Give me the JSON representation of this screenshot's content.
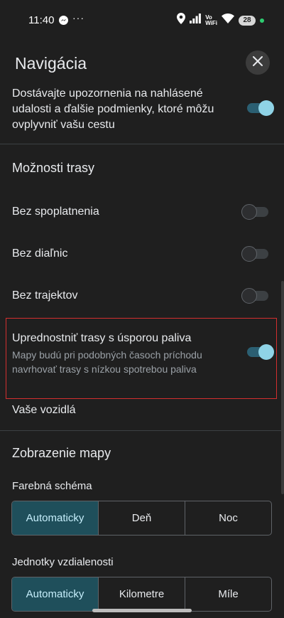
{
  "status_bar": {
    "time": "11:40",
    "dots": "···",
    "vowifi_top": "Vo",
    "vowifi_bottom": "WiFi",
    "battery": "28"
  },
  "header": {
    "title": "Navigácia",
    "close_icon": "close-icon"
  },
  "alerts_row": {
    "text": "Dostávajte upozornenia na nahlásené udalosti a ďalšie podmienky, ktoré môžu ovplyvniť vašu cestu",
    "enabled": true
  },
  "route_options": {
    "title": "Možnosti trasy",
    "items": [
      {
        "label": "Bez spoplatnenia",
        "enabled": false
      },
      {
        "label": "Bez diaľnic",
        "enabled": false
      },
      {
        "label": "Bez trajektov",
        "enabled": false
      }
    ],
    "fuel_efficient": {
      "label": "Uprednostniť trasy s úsporou paliva",
      "description": "Mapy budú pri podobných časoch príchodu navrhovať trasy s nízkou spotrebou paliva",
      "enabled": true
    },
    "vehicles_label": "Vaše vozidlá"
  },
  "map_display": {
    "title": "Zobrazenie mapy",
    "color_scheme": {
      "label": "Farebná schéma",
      "options": [
        "Automaticky",
        "Deň",
        "Noc"
      ],
      "selected": "Automaticky"
    },
    "distance_units": {
      "label": "Jednotky vzdialenosti",
      "options": [
        "Automaticky",
        "Kilometre",
        "Míle"
      ],
      "selected": "Automaticky"
    }
  },
  "colors": {
    "background": "#1f1f1f",
    "toggle_on_track": "#2b5f72",
    "toggle_on_knob": "#8fd3e6",
    "segment_selected": "#1f4f5b",
    "highlight_border": "#d32f2f"
  }
}
